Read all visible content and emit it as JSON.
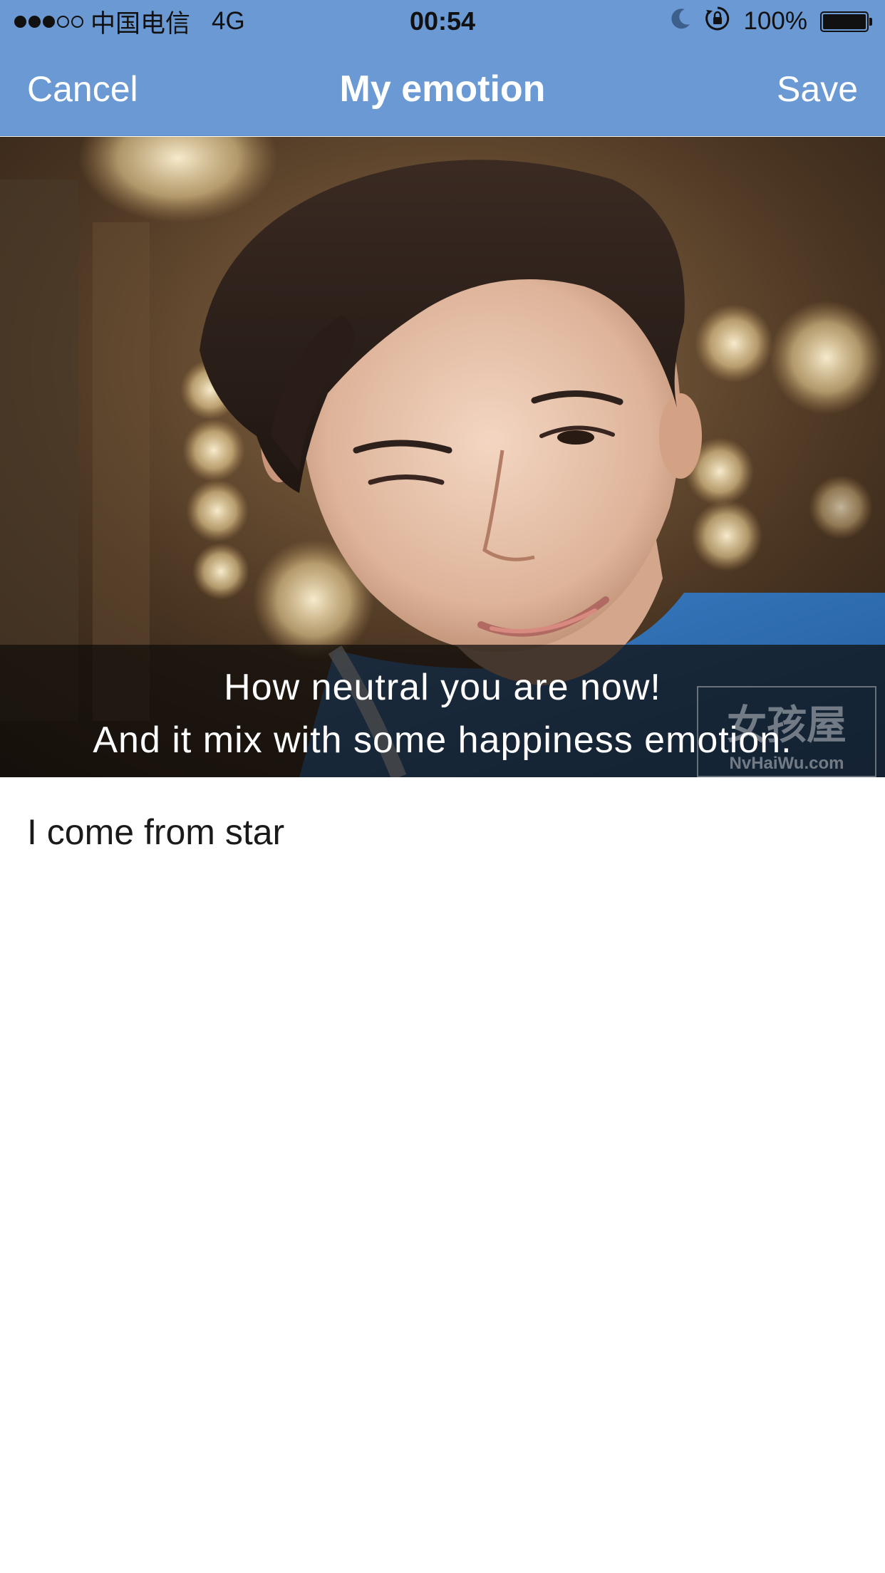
{
  "status_bar": {
    "signal_filled": 3,
    "signal_total": 5,
    "carrier": "中国电信",
    "network": "4G",
    "time": "00:54",
    "battery": "100%",
    "icons": [
      "moon-icon",
      "rotation-lock-icon",
      "battery-icon"
    ]
  },
  "nav": {
    "cancel_label": "Cancel",
    "title": "My emotion",
    "save_label": "Save",
    "background_color": "#6a99d3"
  },
  "photo": {
    "caption_line1": "How neutral you are now!",
    "caption_line2": "And it mix with some happiness emotion.",
    "watermark_cn": "女孩屋",
    "watermark_en": "NvHaiWu.com"
  },
  "note": {
    "text": "I come from star"
  }
}
